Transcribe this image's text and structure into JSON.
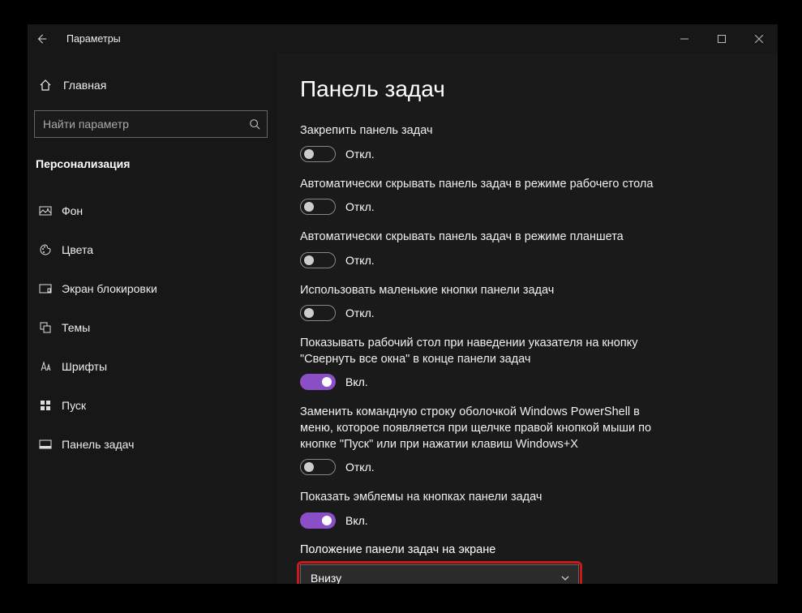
{
  "titlebar": {
    "title": "Параметры"
  },
  "sidebar": {
    "home": "Главная",
    "search_placeholder": "Найти параметр",
    "section": "Персонализация",
    "items": [
      {
        "label": "Фон"
      },
      {
        "label": "Цвета"
      },
      {
        "label": "Экран блокировки"
      },
      {
        "label": "Темы"
      },
      {
        "label": "Шрифты"
      },
      {
        "label": "Пуск"
      },
      {
        "label": "Панель задач"
      }
    ]
  },
  "page": {
    "title": "Панель задач",
    "state_on": "Вкл.",
    "state_off": "Откл.",
    "settings": [
      {
        "label": "Закрепить панель задач",
        "on": false
      },
      {
        "label": "Автоматически скрывать панель задач в режиме рабочего стола",
        "on": false
      },
      {
        "label": "Автоматически скрывать панель задач в режиме планшета",
        "on": false
      },
      {
        "label": "Использовать маленькие кнопки панели задач",
        "on": false
      },
      {
        "label": "Показывать рабочий стол при наведении указателя на кнопку \"Свернуть все окна\" в конце панели задач",
        "on": true
      },
      {
        "label": "Заменить командную строку оболочкой Windows PowerShell в меню, которое появляется при щелчке правой кнопкой мыши по кнопке \"Пуск\" или при нажатии клавиш Windows+X",
        "on": false
      },
      {
        "label": "Показать эмблемы на кнопках панели задач",
        "on": true
      }
    ],
    "position": {
      "label": "Положение панели задач на экране",
      "value": "Внизу"
    }
  }
}
